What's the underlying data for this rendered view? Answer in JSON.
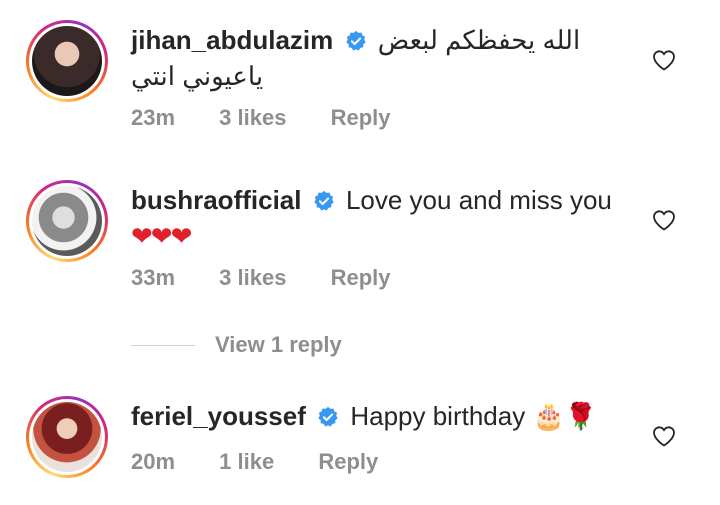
{
  "comments": [
    {
      "username": "jihan_abdulazim",
      "text": "الله يحفظكم لبعض ياعيوني انتي",
      "time": "23m",
      "likes": "3 likes",
      "reply": "Reply"
    },
    {
      "username": "bushraofficial",
      "text": "Love you and miss you",
      "emoji": "❤❤❤",
      "time": "33m",
      "likes": "3 likes",
      "reply": "Reply"
    },
    {
      "username": "feriel_youssef",
      "text": "Happy birthday",
      "emoji": "🎂🌹",
      "time": "20m",
      "likes": "1 like",
      "reply": "Reply"
    }
  ],
  "view_replies": "View 1 reply",
  "colors": {
    "verified": "#3897f0",
    "meta": "#8e8e8e",
    "heart_emoji": "#e0202c"
  },
  "icons": {
    "verified": "verified-badge-icon",
    "like": "heart-outline-icon"
  }
}
